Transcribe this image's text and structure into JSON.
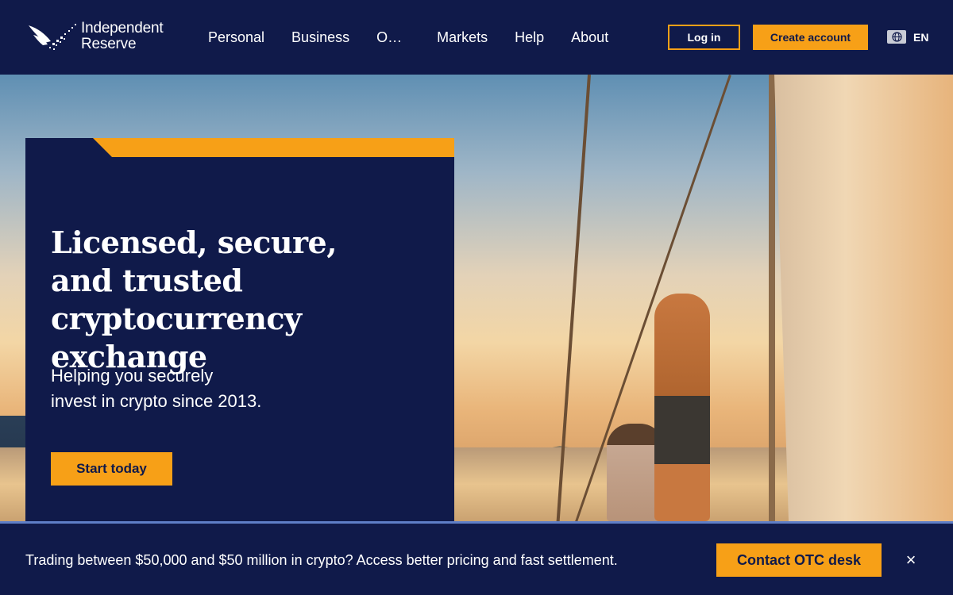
{
  "header": {
    "logo": {
      "line1": "Independent",
      "line2": "Reserve"
    },
    "nav": [
      "Personal",
      "Business",
      "O…",
      "Markets",
      "Help",
      "About"
    ],
    "login_label": "Log in",
    "create_label": "Create account",
    "language": "EN"
  },
  "hero": {
    "title_lines": [
      "Licensed, secure,",
      "and trusted",
      "cryptocurrency exchange"
    ],
    "subtitle_lines": [
      "Helping you securely",
      "invest in crypto since 2013."
    ],
    "cta_label": "Start today"
  },
  "banner": {
    "text": "Trading between $50,000 and $50 million in crypto? Access better pricing and fast settlement.",
    "cta_label": "Contact OTC desk",
    "close_label": "×"
  },
  "colors": {
    "navy": "#101a4a",
    "accent": "#f7a017",
    "banner_border": "#5f7ec7"
  },
  "icons": [
    "logo-wings-icon",
    "globe-icon",
    "close-icon"
  ]
}
